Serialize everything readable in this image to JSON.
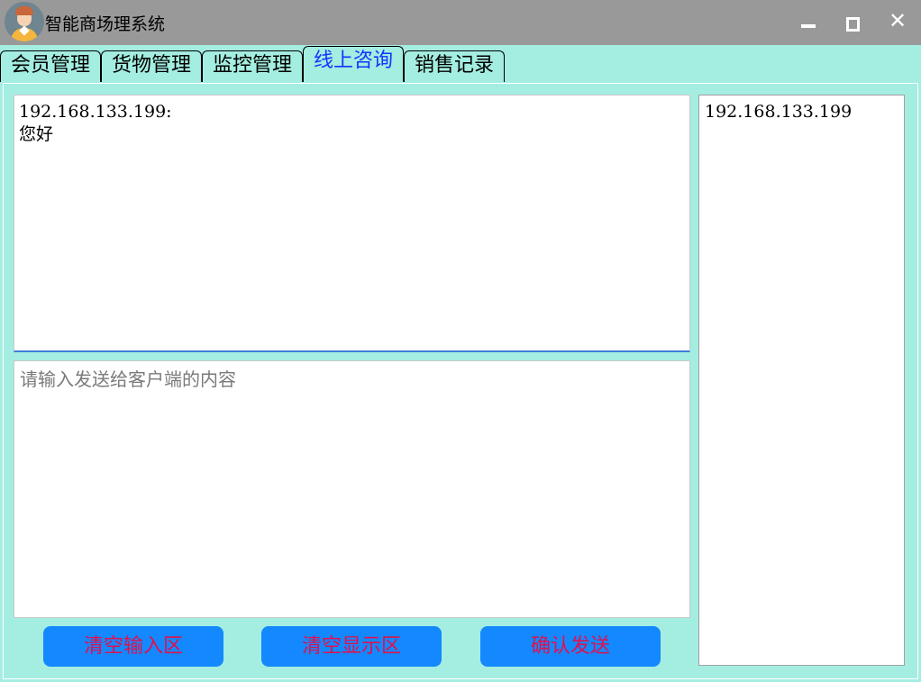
{
  "window": {
    "title": "智能商场理系统",
    "minimize_icon": "minimize-icon",
    "maximize_icon": "maximize-icon",
    "close_icon": "close-icon",
    "close_glyph": "✕"
  },
  "tabs": [
    {
      "label": "会员管理",
      "active": false
    },
    {
      "label": "货物管理",
      "active": false
    },
    {
      "label": "监控管理",
      "active": false
    },
    {
      "label": "线上咨询",
      "active": true
    },
    {
      "label": "销售记录",
      "active": false
    }
  ],
  "chat": {
    "messages": [
      {
        "sender": "192.168.133.199:",
        "text": "您好"
      }
    ],
    "input_value": "",
    "input_placeholder": "请输入发送给客户端的内容"
  },
  "clients": [
    "192.168.133.199"
  ],
  "buttons": {
    "clear_input": "清空输入区",
    "clear_display": "清空显示区",
    "send": "确认发送"
  },
  "colors": {
    "titlebar": "#999999",
    "background": "#a4ede1",
    "active_tab_text": "#1433ff",
    "button_bg": "#1488ff",
    "button_text": "#e0114d"
  }
}
